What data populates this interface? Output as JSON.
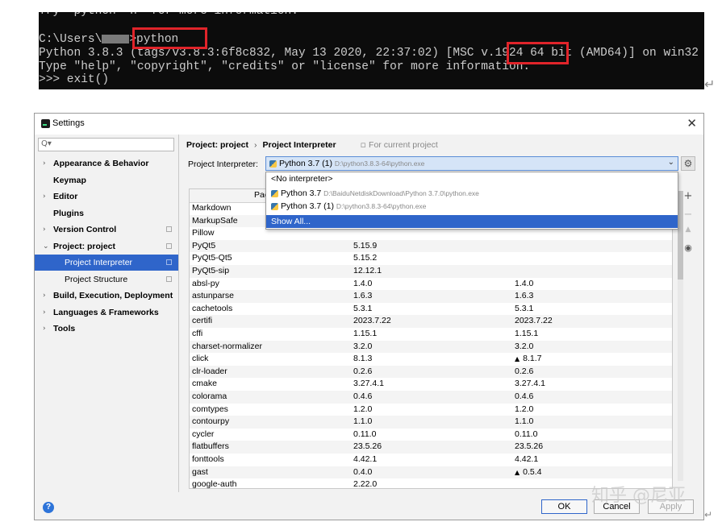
{
  "terminal": {
    "line0": "Try \"python -h\" for more information.",
    "line1_prefix": "C:\\Users\\",
    "line1_cmd": ">python",
    "line2_a": "Python 3.8.3 (tags/v3.8.3:6f8c832, May 13 2020, 22:37:02) [MSC v.1924 ",
    "line2_b": "64 bit",
    "line2_c": " (AMD64)] on win32",
    "line3": "Type \"help\", \"copyright\", \"credits\" or \"license\" for more information.",
    "line4": ">>> exit()"
  },
  "dialog": {
    "title": "Settings",
    "close_icon": "close-icon",
    "search": {
      "placeholder": "Q▾"
    },
    "sidebar": {
      "items": [
        {
          "label": "Appearance & Behavior",
          "expandable": true,
          "indent": 0
        },
        {
          "label": "Keymap",
          "expandable": false,
          "indent": 0
        },
        {
          "label": "Editor",
          "expandable": true,
          "indent": 0
        },
        {
          "label": "Plugins",
          "expandable": false,
          "indent": 0
        },
        {
          "label": "Version Control",
          "expandable": true,
          "indent": 0
        },
        {
          "label": "Project: project",
          "expandable": true,
          "expanded": true,
          "indent": 0
        },
        {
          "label": "Project Interpreter",
          "selected": true,
          "indent": 1
        },
        {
          "label": "Project Structure",
          "indent": 1
        },
        {
          "label": "Build, Execution, Deployment",
          "expandable": true,
          "indent": 0
        },
        {
          "label": "Languages & Frameworks",
          "expandable": true,
          "indent": 0
        },
        {
          "label": "Tools",
          "expandable": true,
          "indent": 0
        }
      ]
    },
    "breadcrumb": {
      "root": "Project: project",
      "separator": "›",
      "current": "Project Interpreter",
      "note": "For current project"
    },
    "interpreter": {
      "label": "Project Interpreter:",
      "selected_name": "Python 3.7 (1)",
      "selected_path": "D:\\python3.8.3-64\\python.exe",
      "options": [
        {
          "name": "<No interpreter>",
          "path": ""
        },
        {
          "name": "Python 3.7",
          "path": "D:\\BaiduNetdiskDownload\\Python 3.7.0\\python.exe"
        },
        {
          "name": "Python 3.7 (1)",
          "path": "D:\\python3.8.3-64\\python.exe"
        },
        {
          "name": "Show All...",
          "path": "",
          "highlighted": true
        }
      ]
    },
    "packages": {
      "header_package": "Pac",
      "rows": [
        {
          "name": "Markdown",
          "version": "",
          "latest": "",
          "upgrade": false
        },
        {
          "name": "MarkupSafe",
          "version": "",
          "latest": "",
          "upgrade": false
        },
        {
          "name": "Pillow",
          "version": "",
          "latest": "",
          "upgrade": false
        },
        {
          "name": "PyQt5",
          "version": "5.15.9",
          "latest": "",
          "upgrade": false
        },
        {
          "name": "PyQt5-Qt5",
          "version": "5.15.2",
          "latest": "",
          "upgrade": false
        },
        {
          "name": "PyQt5-sip",
          "version": "12.12.1",
          "latest": "",
          "upgrade": false
        },
        {
          "name": "absl-py",
          "version": "1.4.0",
          "latest": "1.4.0",
          "upgrade": false
        },
        {
          "name": "astunparse",
          "version": "1.6.3",
          "latest": "1.6.3",
          "upgrade": false
        },
        {
          "name": "cachetools",
          "version": "5.3.1",
          "latest": "5.3.1",
          "upgrade": false
        },
        {
          "name": "certifi",
          "version": "2023.7.22",
          "latest": "2023.7.22",
          "upgrade": false
        },
        {
          "name": "cffi",
          "version": "1.15.1",
          "latest": "1.15.1",
          "upgrade": false
        },
        {
          "name": "charset-normalizer",
          "version": "3.2.0",
          "latest": "3.2.0",
          "upgrade": false
        },
        {
          "name": "click",
          "version": "8.1.3",
          "latest": "8.1.7",
          "upgrade": true
        },
        {
          "name": "clr-loader",
          "version": "0.2.6",
          "latest": "0.2.6",
          "upgrade": false
        },
        {
          "name": "cmake",
          "version": "3.27.4.1",
          "latest": "3.27.4.1",
          "upgrade": false
        },
        {
          "name": "colorama",
          "version": "0.4.6",
          "latest": "0.4.6",
          "upgrade": false
        },
        {
          "name": "comtypes",
          "version": "1.2.0",
          "latest": "1.2.0",
          "upgrade": false
        },
        {
          "name": "contourpy",
          "version": "1.1.0",
          "latest": "1.1.0",
          "upgrade": false
        },
        {
          "name": "cycler",
          "version": "0.11.0",
          "latest": "0.11.0",
          "upgrade": false
        },
        {
          "name": "flatbuffers",
          "version": "23.5.26",
          "latest": "23.5.26",
          "upgrade": false
        },
        {
          "name": "fonttools",
          "version": "4.42.1",
          "latest": "4.42.1",
          "upgrade": false
        },
        {
          "name": "gast",
          "version": "0.4.0",
          "latest": "0.5.4",
          "upgrade": true
        },
        {
          "name": "google-auth",
          "version": "2.22.0",
          "latest": "",
          "upgrade": false
        }
      ]
    },
    "side_tools": [
      "+",
      "−",
      "▲",
      "◉"
    ],
    "buttons": {
      "ok": "OK",
      "cancel": "Cancel",
      "apply": "Apply",
      "help": "?"
    }
  },
  "watermark": "知乎 @尼亚",
  "colors": {
    "selection": "#2f65ca",
    "highlight_box": "#e0242a",
    "terminal_bg": "#0c0c0c"
  }
}
